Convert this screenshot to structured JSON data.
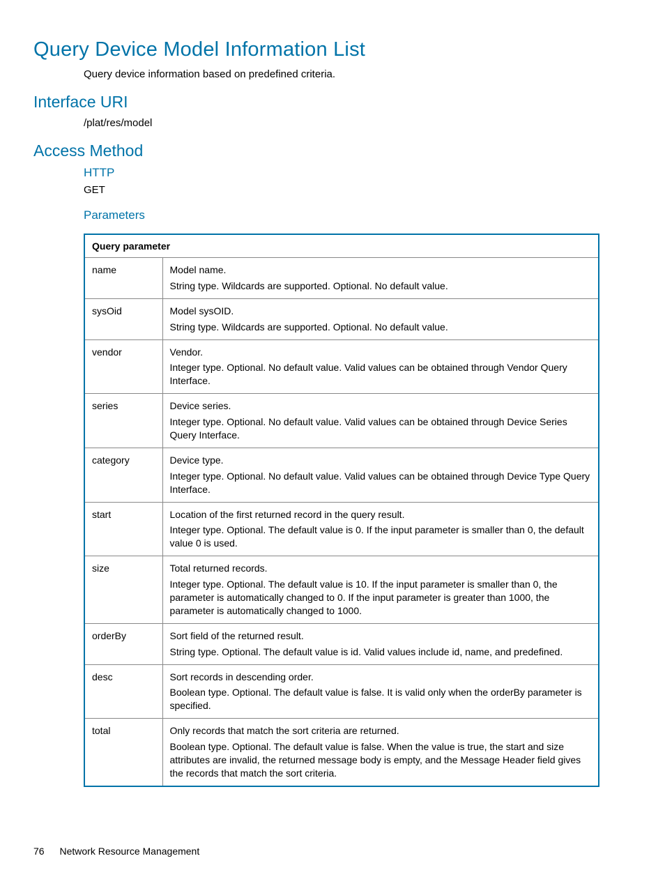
{
  "title": "Query Device Model Information List",
  "intro": "Query device information based on predefined criteria.",
  "sections": {
    "interface_uri": {
      "heading": "Interface URI",
      "value": "/plat/res/model"
    },
    "access_method": {
      "heading": "Access Method",
      "http_label": "HTTP",
      "http_value": "GET",
      "params_label": "Parameters"
    }
  },
  "table": {
    "header": "Query parameter",
    "rows": [
      {
        "name": "name",
        "lines": [
          "Model name.",
          "String type. Wildcards are supported. Optional. No default value."
        ]
      },
      {
        "name": "sysOid",
        "lines": [
          "Model sysOID.",
          "String type. Wildcards are supported. Optional. No default value."
        ]
      },
      {
        "name": "vendor",
        "lines": [
          "Vendor.",
          "Integer type. Optional. No default value. Valid values can be obtained through Vendor Query Interface."
        ]
      },
      {
        "name": "series",
        "lines": [
          "Device series.",
          "Integer type. Optional. No default value. Valid values can be obtained through Device Series Query Interface."
        ]
      },
      {
        "name": "category",
        "lines": [
          "Device type.",
          "Integer type. Optional. No default value. Valid values can be obtained through Device Type Query Interface."
        ]
      },
      {
        "name": "start",
        "lines": [
          "Location of the first returned record in the query result.",
          "Integer type. Optional. The default value is 0. If the input parameter is smaller than 0, the default value 0 is used."
        ]
      },
      {
        "name": "size",
        "lines": [
          "Total returned records.",
          "Integer type. Optional. The default value is 10. If the input parameter is smaller than 0, the parameter is automatically changed to 0. If the input parameter is greater than 1000, the parameter is automatically changed to 1000."
        ]
      },
      {
        "name": "orderBy",
        "lines": [
          "Sort field of the returned result.",
          "String type. Optional. The default value is id. Valid values include id, name, and predefined."
        ]
      },
      {
        "name": "desc",
        "lines": [
          "Sort records in descending order.",
          "Boolean type. Optional. The default value is false. It is valid only when the orderBy parameter is specified."
        ]
      },
      {
        "name": "total",
        "lines": [
          "Only records that match the sort criteria are returned.",
          "Boolean type. Optional. The default value is false. When the value is true, the start and size attributes are invalid, the returned message body is empty, and the Message Header field gives the records that match the sort criteria."
        ]
      }
    ]
  },
  "footer": {
    "page": "76",
    "section": "Network Resource Management"
  }
}
